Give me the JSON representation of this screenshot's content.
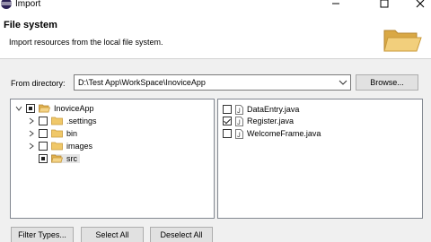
{
  "window": {
    "title": "Import",
    "icon": "eclipse-icon"
  },
  "header": {
    "title": "File system",
    "description": "Import resources from the local file system.",
    "icon": "folder-open-icon"
  },
  "directory": {
    "label": "From directory:",
    "value": "D:\\Test App\\WorkSpace\\InoviceApp",
    "browse_label": "Browse..."
  },
  "tree": {
    "root": {
      "label": "InoviceApp",
      "state": "partial",
      "expanded": true
    },
    "children": [
      {
        "label": ".settings",
        "state": "unchecked",
        "expandable": true
      },
      {
        "label": "bin",
        "state": "unchecked",
        "expandable": true
      },
      {
        "label": "images",
        "state": "unchecked",
        "expandable": true
      },
      {
        "label": "src",
        "state": "partial",
        "expandable": false,
        "selected": true
      }
    ]
  },
  "files": [
    {
      "label": "DataEntry.java",
      "checked": false
    },
    {
      "label": "Register.java",
      "checked": true
    },
    {
      "label": "WelcomeFrame.java",
      "checked": false
    }
  ],
  "buttons": {
    "filter_types": "Filter Types...",
    "select_all": "Select All",
    "deselect_all": "Deselect All"
  },
  "colors": {
    "folder": "#e8c170",
    "folder_dark": "#c99a3a",
    "selection": "#e5e5e5"
  }
}
